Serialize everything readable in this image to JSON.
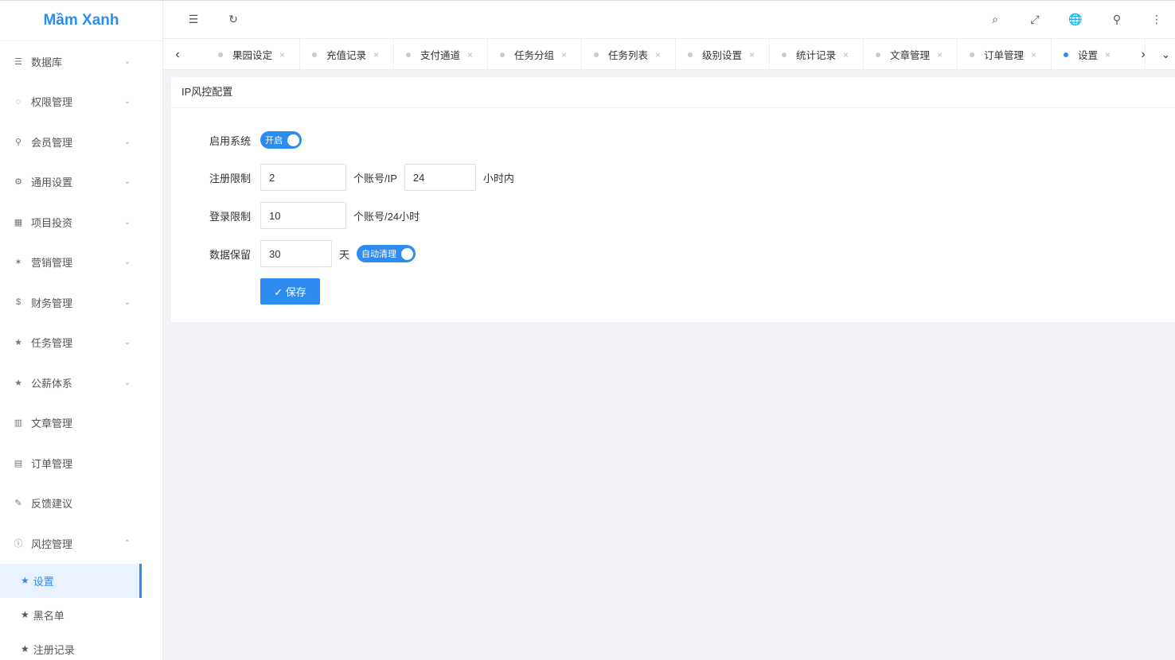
{
  "logo": "Mầm Xanh",
  "sidebar": {
    "items": [
      {
        "icon": "☰",
        "label": "数据库"
      },
      {
        "icon": "◌",
        "label": "权限管理"
      },
      {
        "icon": "⚲",
        "label": "会员管理"
      },
      {
        "icon": "⚙",
        "label": "通用设置"
      },
      {
        "icon": "▦",
        "label": "项目投资"
      },
      {
        "icon": "✶",
        "label": "营销管理"
      },
      {
        "icon": "$",
        "label": "财务管理"
      },
      {
        "icon": "★",
        "label": "任务管理"
      },
      {
        "icon": "★",
        "label": "公薪体系"
      },
      {
        "icon": "▥",
        "label": "文章管理"
      },
      {
        "icon": "▤",
        "label": "订单管理"
      },
      {
        "icon": "✎",
        "label": "反馈建议"
      },
      {
        "icon": "ⓘ",
        "label": "风控管理"
      }
    ],
    "subitems": [
      {
        "icon": "★",
        "label": "设置"
      },
      {
        "icon": "★",
        "label": "黑名单"
      },
      {
        "icon": "★",
        "label": "注册记录"
      }
    ],
    "arrow_down": "⌄",
    "arrow_up": "⌃"
  },
  "header": {
    "menu_icon": "☰",
    "refresh_icon": "↻",
    "search_icon": "⌕",
    "fullscreen_icon": "⤢",
    "globe_icon": "🌐",
    "user_icon": "⚲",
    "more_icon": "⋮"
  },
  "tabs": {
    "prev": "‹",
    "next": "›",
    "dropdown": "⌄",
    "close": "×",
    "items": [
      "果园设定",
      "充值记录",
      "支付通道",
      "任务分组",
      "任务列表",
      "级别设置",
      "统计记录",
      "文章管理",
      "订单管理",
      "设置"
    ]
  },
  "card": {
    "title": "IP风控配置",
    "enable_label": "启用系统",
    "enable_switch": "开启",
    "reg_label": "注册限制",
    "reg_count": "2",
    "reg_unit1": "个账号/IP",
    "reg_hours": "24",
    "reg_unit2": "小时内",
    "login_label": "登录限制",
    "login_count": "10",
    "login_unit": "个账号/24小时",
    "data_label": "数据保留",
    "data_days": "30",
    "data_unit": "天",
    "auto_clean_switch": "自动清理",
    "save_label": "✓ 保存"
  }
}
